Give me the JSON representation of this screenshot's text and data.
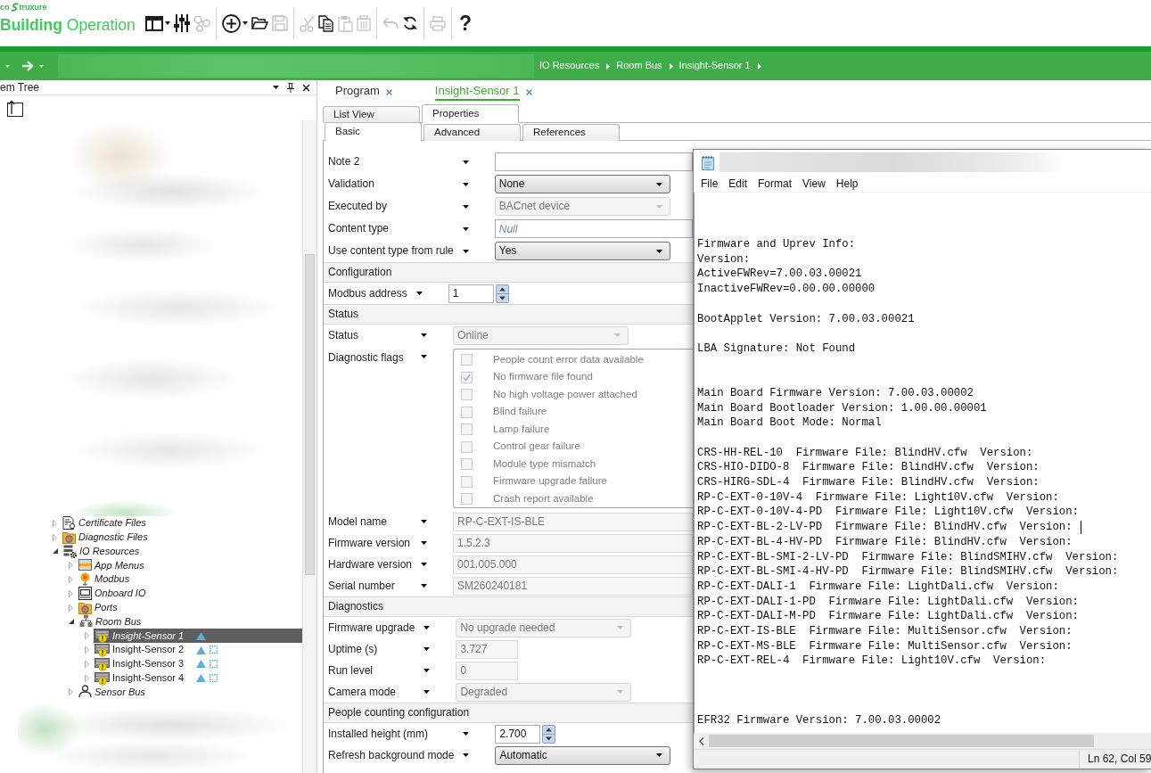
{
  "header": {
    "logo": {
      "left_text": "co",
      "right_text": "truxure"
    },
    "product": "**Building** Operation",
    "toolbar": [
      [
        {
          "kind": "layout",
          "dropdown": true,
          "disabled": false
        },
        {
          "kind": "settings",
          "dropdown": false,
          "disabled": false
        },
        {
          "kind": "network",
          "dropdown": false,
          "disabled": true
        }
      ],
      [
        {
          "kind": "add",
          "dropdown": true,
          "disabled": false
        },
        {
          "kind": "open",
          "dropdown": false,
          "disabled": false
        },
        {
          "kind": "save",
          "dropdown": false,
          "disabled": true
        }
      ],
      [
        {
          "kind": "cut",
          "dropdown": false,
          "disabled": true
        },
        {
          "kind": "copy",
          "dropdown": false,
          "disabled": false
        },
        {
          "kind": "paste",
          "dropdown": false,
          "disabled": true
        },
        {
          "kind": "delete",
          "dropdown": false,
          "disabled": true
        }
      ],
      [
        {
          "kind": "undo",
          "dropdown": false,
          "disabled": true
        },
        {
          "kind": "refresh",
          "dropdown": false,
          "disabled": false
        }
      ],
      [
        {
          "kind": "print",
          "dropdown": false,
          "disabled": true
        }
      ],
      [
        {
          "kind": "help",
          "label": "?",
          "dropdown": false,
          "disabled": false
        }
      ]
    ]
  },
  "nav_bar": {
    "breadcrumb": [
      "IO Resources",
      "Room Bus",
      "Insight-Sensor 1"
    ]
  },
  "tree_panel": {
    "title": "em Tree",
    "nodes": [
      {
        "label": "Certificate Files",
        "kind": "certificate",
        "italic": true,
        "expanded": false,
        "selected": false
      },
      {
        "label": "Diagnostic Files",
        "kind": "folder",
        "italic": true,
        "expanded": false,
        "selected": false
      },
      {
        "label": "IO Resources",
        "kind": "io",
        "italic": true,
        "expanded": true,
        "selected": false,
        "children": [
          {
            "label": "App Menus",
            "kind": "menus",
            "italic": true,
            "expanded": false,
            "selected": false
          },
          {
            "label": "Modbus",
            "kind": "modbus",
            "italic": true,
            "expanded": false,
            "selected": false
          },
          {
            "label": "Onboard IO",
            "kind": "onboard",
            "italic": true,
            "expanded": false,
            "selected": false
          },
          {
            "label": "Ports",
            "kind": "folder",
            "italic": true,
            "expanded": false,
            "selected": false
          },
          {
            "label": "Room Bus",
            "kind": "bus",
            "italic": true,
            "expanded": true,
            "selected": false,
            "children": [
              {
                "label": "Insight-Sensor 1",
                "kind": "sensor",
                "italic": true,
                "expanded": false,
                "selected": true,
                "dotted_marker": false
              },
              {
                "label": "Insight-Sensor 2",
                "kind": "sensor",
                "italic": false,
                "expanded": false,
                "selected": false,
                "dotted_marker": true
              },
              {
                "label": "Insight-Sensor 3",
                "kind": "sensor",
                "italic": false,
                "expanded": false,
                "selected": false,
                "dotted_marker": true
              },
              {
                "label": "Insight-Sensor 4",
                "kind": "sensor",
                "italic": false,
                "expanded": false,
                "selected": false,
                "dotted_marker": true
              }
            ]
          },
          {
            "label": "Sensor Bus",
            "kind": "sensor-bus",
            "italic": true,
            "expanded": false,
            "selected": false
          }
        ]
      }
    ]
  },
  "document_tabs": [
    {
      "label": "Program",
      "selected": false
    },
    {
      "label": "Insight-Sensor 1",
      "selected": true
    }
  ],
  "view_tabs": [
    {
      "label": "List View",
      "selected": false
    },
    {
      "label": "Properties",
      "selected": true
    }
  ],
  "property_tabs": [
    {
      "label": "Basic",
      "selected": true
    },
    {
      "label": "Advanced",
      "selected": false
    },
    {
      "label": "References",
      "selected": false
    }
  ],
  "properties": {
    "sections": [
      {
        "rows": [
          {
            "label": "Note 2",
            "kind": "text",
            "disabled": false
          },
          {
            "label": "Validation",
            "kind": "select",
            "value": "None",
            "disabled": false
          },
          {
            "label": "Executed by",
            "kind": "select",
            "value": "BACnet device",
            "disabled": true
          },
          {
            "label": "Content type",
            "kind": "text",
            "placeholder": "Null",
            "disabled": false
          },
          {
            "label": "Use content type from rule",
            "kind": "select",
            "value": "Yes",
            "disabled": false
          }
        ]
      },
      {
        "title": "Configuration",
        "rows": [
          {
            "label": "Modbus address",
            "kind": "spin",
            "value": "1",
            "disabled": false
          }
        ]
      },
      {
        "title": "Status",
        "rows": [
          {
            "label": "Status",
            "kind": "select",
            "value": "Online",
            "disabled": true
          },
          {
            "label": "Diagnostic flags",
            "kind": "flags",
            "disabled": true,
            "items": [
              {
                "label": "People count error data available",
                "checked": false
              },
              {
                "label": "No firmware file found",
                "checked": true
              },
              {
                "label": "No high voltage power attached",
                "checked": false
              },
              {
                "label": "Blind failure",
                "checked": false
              },
              {
                "label": "Lamp failure",
                "checked": false
              },
              {
                "label": "Control gear failure",
                "checked": false
              },
              {
                "label": "Module type mismatch",
                "checked": false
              },
              {
                "label": "Firmware upgrade failure",
                "checked": false
              },
              {
                "label": "Crash report available",
                "checked": false
              }
            ]
          },
          {
            "label": "Model name",
            "kind": "text",
            "value": "RP-C-EXT-IS-BLE",
            "disabled": true
          },
          {
            "label": "Firmware version",
            "kind": "text",
            "value": "1.5.2.3",
            "disabled": true
          },
          {
            "label": "Hardware version",
            "kind": "text",
            "value": "001.005.000",
            "disabled": true
          },
          {
            "label": "Serial number",
            "kind": "text",
            "value": "SM260240181",
            "disabled": true
          }
        ]
      },
      {
        "title": "Diagnostics",
        "rows": [
          {
            "label": "Firmware upgrade",
            "kind": "select",
            "value": "No upgrade needed",
            "disabled": true
          },
          {
            "label": "Uptime (s)",
            "kind": "short",
            "value": "3.727",
            "disabled": true
          },
          {
            "label": "Run level",
            "kind": "short",
            "value": "0",
            "disabled": true
          },
          {
            "label": "Camera mode",
            "kind": "select",
            "value": "Degraded",
            "disabled": true
          }
        ]
      },
      {
        "title": "People counting configuration",
        "rows": [
          {
            "label": "Installed height (mm)",
            "kind": "spin",
            "value": "2.700",
            "disabled": false
          },
          {
            "label": "Refresh background mode",
            "kind": "select",
            "value": "Automatic",
            "disabled": false
          }
        ]
      }
    ]
  },
  "notepad": {
    "menu": [
      "File",
      "Edit",
      "Format",
      "View",
      "Help"
    ],
    "lines": [
      {
        "kind": "blank",
        "cursor": false
      },
      {
        "kind": "blank",
        "cursor": false
      },
      {
        "kind": "blank",
        "cursor": false
      },
      {
        "kind": "text",
        "text": "Firmware and Uprev Info:",
        "cursor": false
      },
      {
        "kind": "text",
        "text": "Version:",
        "cursor": false
      },
      {
        "kind": "text",
        "text": "ActiveFWRev=7.00.03.00021",
        "cursor": false
      },
      {
        "kind": "text",
        "text": "InactiveFWRev=0.00.00.00000",
        "cursor": false
      },
      {
        "kind": "blank",
        "cursor": false
      },
      {
        "kind": "text",
        "text": "BootApplet Version: 7.00.03.00021",
        "cursor": false
      },
      {
        "kind": "blank",
        "cursor": false
      },
      {
        "kind": "text",
        "text": "LBA Signature: Not Found",
        "cursor": false
      },
      {
        "kind": "blank",
        "cursor": false
      },
      {
        "kind": "blank",
        "cursor": false
      },
      {
        "kind": "text",
        "text": "Main Board Firmware Version: 7.00.03.00002",
        "cursor": false
      },
      {
        "kind": "text",
        "text": "Main Board Bootloader Version: 1.00.00.00001",
        "cursor": false
      },
      {
        "kind": "text",
        "text": "Main Board Boot Mode: Normal",
        "cursor": false
      },
      {
        "kind": "blank",
        "cursor": false
      },
      {
        "kind": "text",
        "text": "CRS-HH-REL-10  Firmware File: BlindHV.cfw  Version:",
        "cursor": false
      },
      {
        "kind": "text",
        "text": "CRS-HIO-DIDO-8  Firmware File: BlindHV.cfw  Version:",
        "cursor": false
      },
      {
        "kind": "text",
        "text": "CRS-HIRG-SDL-4  Firmware File: BlindHV.cfw  Version:",
        "cursor": false
      },
      {
        "kind": "text",
        "text": "RP-C-EXT-0-10V-4  Firmware File: Light10V.cfw  Version:",
        "cursor": false
      },
      {
        "kind": "text",
        "text": "RP-C-EXT-0-10V-4-PD  Firmware File: Light10V.cfw  Version:",
        "cursor": false
      },
      {
        "kind": "text",
        "text": "RP-C-EXT-BL-2-LV-PD  Firmware File: BlindHV.cfw  Version:",
        "cursor": true
      },
      {
        "kind": "text",
        "text": "RP-C-EXT-BL-4-HV-PD  Firmware File: BlindHV.cfw  Version:",
        "cursor": false
      },
      {
        "kind": "text",
        "text": "RP-C-EXT-BL-SMI-2-LV-PD  Firmware File: BlindSMIHV.cfw  Version:",
        "cursor": false
      },
      {
        "kind": "text",
        "text": "RP-C-EXT-BL-SMI-4-HV-PD  Firmware File: BlindSMIHV.cfw  Version:",
        "cursor": false
      },
      {
        "kind": "text",
        "text": "RP-C-EXT-DALI-1  Firmware File: LightDali.cfw  Version:",
        "cursor": false
      },
      {
        "kind": "text",
        "text": "RP-C-EXT-DALI-1-PD  Firmware File: LightDali.cfw  Version:",
        "cursor": false
      },
      {
        "kind": "text",
        "text": "RP-C-EXT-DALI-M-PD  Firmware File: LightDali.cfw  Version:",
        "cursor": false
      },
      {
        "kind": "text",
        "text": "RP-C-EXT-IS-BLE  Firmware File: MultiSensor.cfw  Version:",
        "cursor": false
      },
      {
        "kind": "text",
        "text": "RP-C-EXT-MS-BLE  Firmware File: MultiSensor.cfw  Version:",
        "cursor": false
      },
      {
        "kind": "text",
        "text": "RP-C-EXT-REL-4  Firmware File: Light10V.cfw  Version:",
        "cursor": false
      },
      {
        "kind": "blank",
        "cursor": false
      },
      {
        "kind": "blank",
        "cursor": false
      },
      {
        "kind": "blank",
        "cursor": false
      },
      {
        "kind": "text",
        "text": "EFR32 Firmware Version: 7.00.03.00002",
        "cursor": false
      }
    ],
    "status": "Ln 62, Col 59"
  }
}
